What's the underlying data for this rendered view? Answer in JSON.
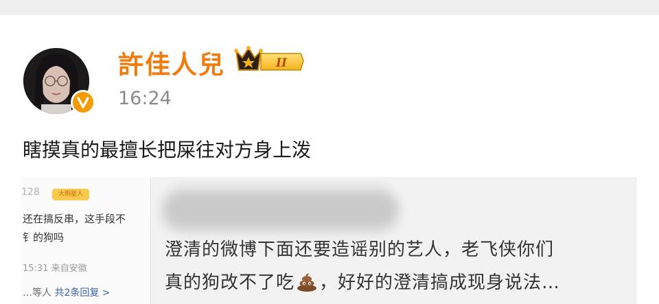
{
  "post": {
    "author": "許佳人兒",
    "time": "16:24",
    "text": "瞎摸真的最擅长把屎往对方身上泼",
    "badge_level": "II"
  },
  "quote": {
    "line1": "澄清的微博下面还要造谣别的艺人，老飞侠你们",
    "line2_before": "真的狗改不了吃",
    "line2_after": "，好好的澄清搞成现身说法…",
    "icon": "poop-icon"
  },
  "thumbnail": {
    "num": "128",
    "tag": "大明星人",
    "line1": "还在搞反串，这手段不",
    "line2": "钅的狗吗",
    "time": "15:31 来自安徽",
    "reply_who": "…等人",
    "reply_link": "共2条回复 >"
  },
  "colors": {
    "username": "#f07c10",
    "verified": "#f59a00",
    "time": "#8a8a8a",
    "card_bg": "#f2f2f2"
  }
}
